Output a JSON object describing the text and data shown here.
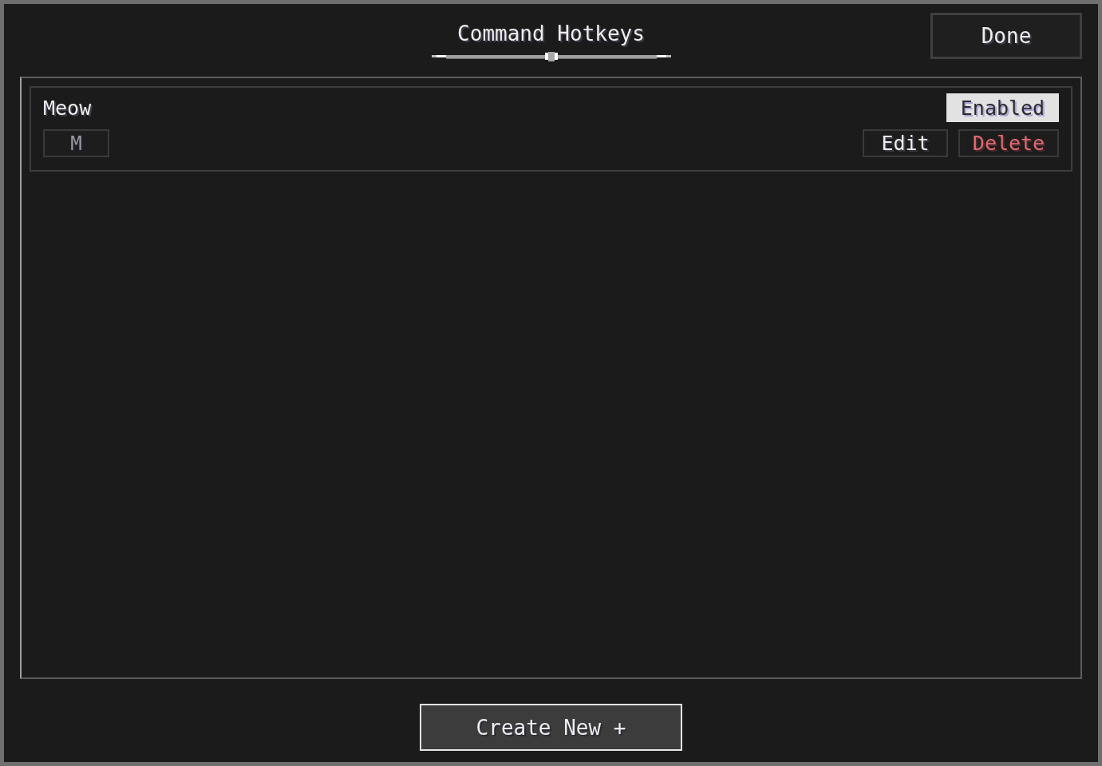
{
  "title": "Command Hotkeys",
  "done_button": "Done",
  "hotkeys": [
    {
      "name": "Meow",
      "key": "M",
      "enabled": true,
      "toggle_label": "Enabled",
      "edit_label": "Edit",
      "delete_label": "Delete"
    }
  ],
  "create_button": "Create New +"
}
